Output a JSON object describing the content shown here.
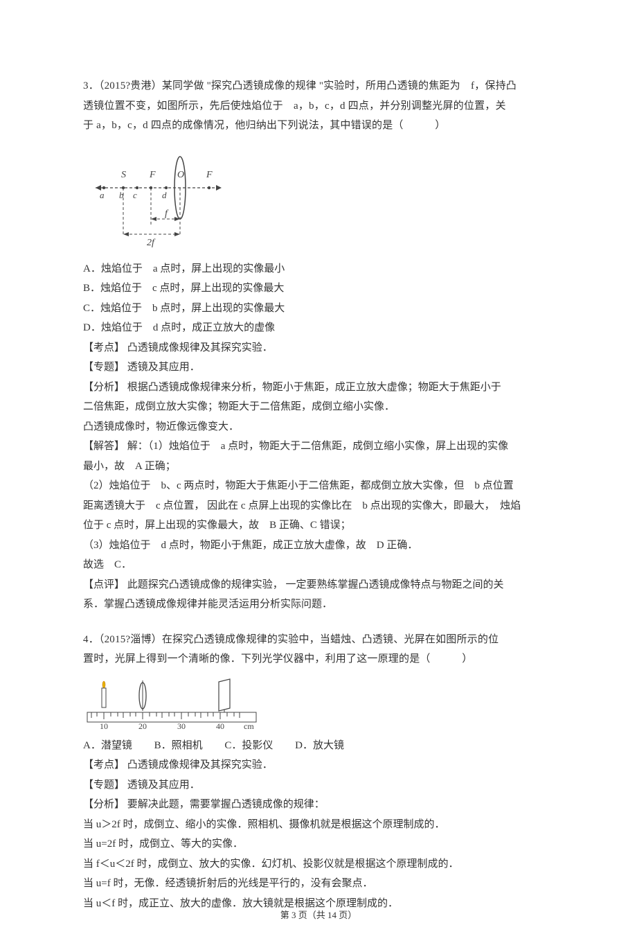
{
  "q3": {
    "stem1": "3．（2015?贵港）某同学做 \"探究凸透镜成像的规律 \"实验时，所用凸透镜的焦距为　f，保持凸",
    "stem2": "透镜位置不变，如图所示，先后使烛焰位于　a，b，c，d 四点，并分别调整光屏的位置，关",
    "stem3": "于 a，b，c，d 四点的成像情况，他归纳出下列说法，其中错误的是（　　　）",
    "optA": "A．烛焰位于　a 点时，屏上出现的实像最小",
    "optB": "B．烛焰位于　c 点时，屏上出现的实像最大",
    "optC": "C．烛焰位于　b 点时，屏上出现的实像最大",
    "optD": "D．烛焰位于　d 点时，成正立放大的虚像",
    "kdian": "【考点】 凸透镜成像规律及其探究实验．",
    "zhuanti": "【专题】 透镜及其应用．",
    "fenxi1": "【分析】 根据凸透镜成像规律来分析，物距小于焦距，成正立放大虚像；物距大于焦距小于",
    "fenxi2": "二倍焦距，成倒立放大实像；物距大于二倍焦距，成倒立缩小实像．",
    "fenxi3": "凸透镜成像时，物近像远像变大．",
    "jieda1": "【解答】 解：（1）烛焰位于　a 点时，物距大于二倍焦距，成倒立缩小实像，屏上出现的实像",
    "jieda2": "最小，故　A 正确；",
    "jieda3": "（2）烛焰位于　b、c 两点时，物距大于焦距小于二倍焦距，都成倒立放大实像，但　b 点位置",
    "jieda4": "距离透镜大于　c 点位置， 因此在 c 点屏上出现的实像比在　b 点出现的实像大，即最大，　烛焰",
    "jieda5": "位于 c 点时，屏上出现的实像最大，故　B 正确、C 错误；",
    "jieda6": "（3）烛焰位于　d 点时，物距小于焦距，成正立放大虚像，故　D 正确．",
    "jieda7": "故选　C．",
    "dianping1": "【点评】 此题探究凸透镜成像的规律实验， 一定要熟练掌握凸透镜成像特点与物距之间的关",
    "dianping2": "系．掌握凸透镜成像规律并能灵活运用分析实际问题．",
    "diagram": {
      "S": "S",
      "F1": "F",
      "O": "O",
      "F2": "F",
      "a": "a",
      "b": "b",
      "c": "c",
      "d": "d",
      "f": "f",
      "twof": "2f"
    }
  },
  "q4": {
    "stem1": "4．（2015?淄博）在探究凸透镜成像规律的实验中，当蜡烛、凸透镜、光屏在如图所示的位",
    "stem2": "置时，光屏上得到一个清晰的像．下列光学仪器中，利用了这一原理的是（　　　）",
    "optA": "A．潜望镜",
    "optB": "B．照相机",
    "optC": "C．投影仪",
    "optD": "D．放大镜",
    "kdian": "【考点】 凸透镜成像规律及其探究实验．",
    "zhuanti": "【专题】 透镜及其应用．",
    "fenxi0": "【分析】 要解决此题，需要掌握凸透镜成像的规律：",
    "fenxi1": "当 u＞2f 时，成倒立、缩小的实像．照相机、摄像机就是根据这个原理制成的．",
    "fenxi2": "当 u=2f 时，成倒立、等大的实像．",
    "fenxi3": "当 f＜u＜2f 时，成倒立、放大的实像．幻灯机、投影仪就是根据这个原理制成的．",
    "fenxi4": "当 u=f 时，无像．经透镜折射后的光线是平行的，没有会聚点．",
    "fenxi5": "当 u＜f 时，成正立、放大的虚像．放大镜就是根据这个原理制成的．",
    "ruler": {
      "ticks": [
        "10",
        "20",
        "30",
        "40",
        "cm"
      ]
    }
  },
  "footer": {
    "prefix": "第",
    "page": "3",
    "mid": "页（共",
    "total": "14",
    "suffix": "页）"
  }
}
